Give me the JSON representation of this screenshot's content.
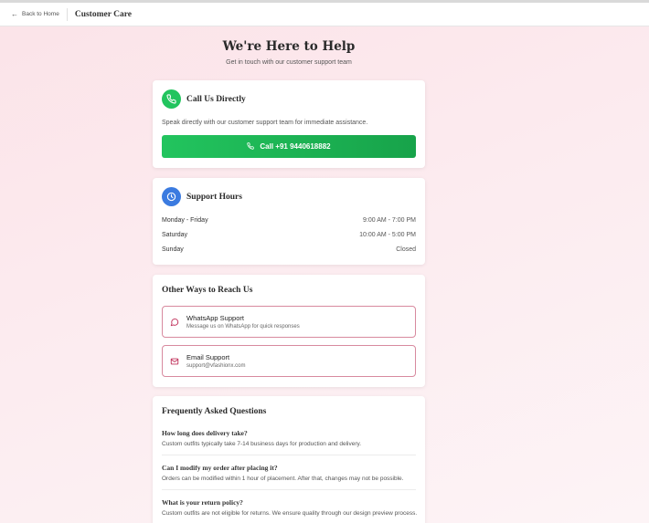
{
  "header": {
    "back_label": "Back to Home",
    "title": "Customer Care"
  },
  "hero": {
    "title": "We're Here to Help",
    "subtitle": "Get in touch with our customer support team"
  },
  "call": {
    "title": "Call Us Directly",
    "description": "Speak directly with our customer support team for immediate assistance.",
    "button_label": "Call +91 9440618882"
  },
  "hours": {
    "title": "Support Hours",
    "rows": [
      {
        "day": "Monday - Friday",
        "time": "9:00 AM - 7:00 PM"
      },
      {
        "day": "Saturday",
        "time": "10:00 AM - 5:00 PM"
      },
      {
        "day": "Sunday",
        "time": "Closed"
      }
    ]
  },
  "other": {
    "title": "Other Ways to Reach Us",
    "whatsapp": {
      "title": "WhatsApp Support",
      "subtitle": "Message us on WhatsApp for quick responses"
    },
    "email": {
      "title": "Email Support",
      "subtitle": "support@vfashionx.com"
    }
  },
  "faq": {
    "title": "Frequently Asked Questions",
    "items": [
      {
        "q": "How long does delivery take?",
        "a": "Custom outfits typically take 7-14 business days for production and delivery."
      },
      {
        "q": "Can I modify my order after placing it?",
        "a": "Orders can be modified within 1 hour of placement. After that, changes may not be possible."
      },
      {
        "q": "What is your return policy?",
        "a": "Custom outfits are not eligible for returns. We ensure quality through our design preview process."
      }
    ]
  },
  "colors": {
    "green": "#22c45e",
    "blue": "#3b7be0",
    "pink_border": "#d88a9f"
  }
}
